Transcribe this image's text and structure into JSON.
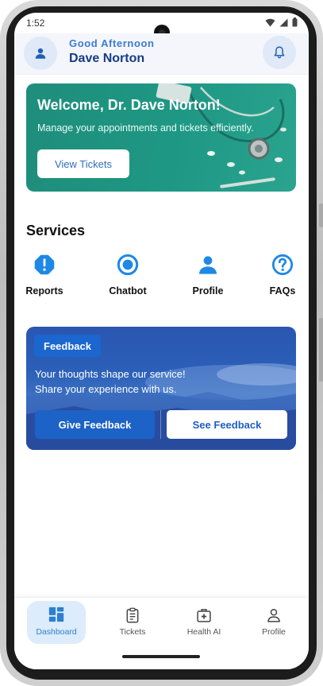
{
  "status_bar": {
    "time": "1:52"
  },
  "header": {
    "greeting": "Good Afternoon",
    "user_name": "Dave Norton"
  },
  "welcome_card": {
    "title": "Welcome, Dr. Dave Norton!",
    "subtitle": "Manage your appointments and tickets efficiently.",
    "button_label": "View Tickets"
  },
  "services": {
    "title": "Services",
    "items": [
      {
        "label": "Reports",
        "icon": "alert-octagon-icon"
      },
      {
        "label": "Chatbot",
        "icon": "radio-circle-icon"
      },
      {
        "label": "Profile",
        "icon": "person-icon"
      },
      {
        "label": "FAQs",
        "icon": "help-circle-icon"
      }
    ]
  },
  "feedback_card": {
    "badge": "Feedback",
    "line1": "Your thoughts shape our service!",
    "line2": "Share your experience with us.",
    "give_label": "Give Feedback",
    "see_label": "See Feedback"
  },
  "bottom_nav": {
    "items": [
      {
        "label": "Dashboard",
        "icon": "dashboard-icon",
        "active": true
      },
      {
        "label": "Tickets",
        "icon": "clipboard-icon",
        "active": false
      },
      {
        "label": "Health AI",
        "icon": "medical-kit-icon",
        "active": false
      },
      {
        "label": "Profile",
        "icon": "person-outline-icon",
        "active": false
      }
    ]
  },
  "colors": {
    "accent": "#1E88E5",
    "header_text": "#163C86",
    "welcome_bg": "#1F8D7B",
    "feedback_bg": "#2A56B0"
  }
}
